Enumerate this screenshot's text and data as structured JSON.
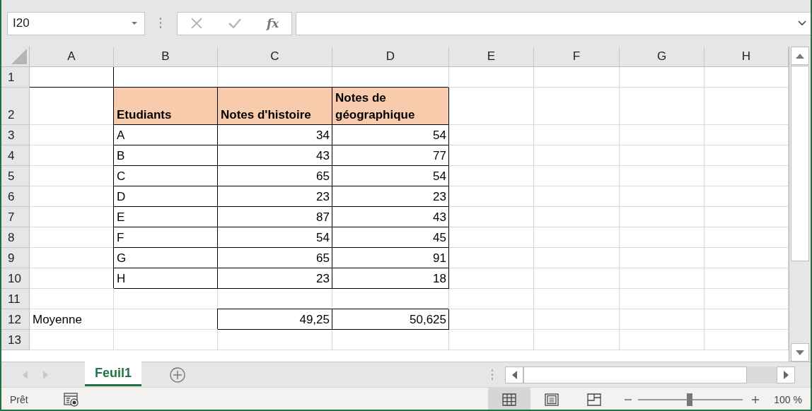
{
  "name_box": {
    "value": "I20"
  },
  "formula_bar": {
    "function_label": "fx"
  },
  "columns": [
    "A",
    "B",
    "C",
    "D",
    "E",
    "F",
    "G",
    "H"
  ],
  "rows": [
    {
      "number": "1",
      "cells": [
        {
          "edge_lines": true
        },
        {},
        {},
        {},
        {},
        {},
        {},
        {}
      ]
    },
    {
      "number": "2",
      "cells": [
        {},
        {
          "text": "Etudiants",
          "bold": true,
          "shaded": true,
          "bordered": true
        },
        {
          "text": "Notes d'histoire",
          "bold": true,
          "shaded": true,
          "bordered": true
        },
        {
          "text": "Notes de géographique",
          "bold": true,
          "shaded": true,
          "bordered": true
        },
        {},
        {},
        {},
        {}
      ]
    },
    {
      "number": "3",
      "cells": [
        {},
        {
          "text": "A",
          "bordered": true
        },
        {
          "text": "34",
          "right_aligned": true,
          "bordered": true
        },
        {
          "text": "54",
          "right_aligned": true,
          "bordered": true
        },
        {},
        {},
        {},
        {}
      ]
    },
    {
      "number": "4",
      "cells": [
        {},
        {
          "text": "B",
          "bordered": true
        },
        {
          "text": "43",
          "right_aligned": true,
          "bordered": true
        },
        {
          "text": "77",
          "right_aligned": true,
          "bordered": true
        },
        {},
        {},
        {},
        {}
      ]
    },
    {
      "number": "5",
      "cells": [
        {},
        {
          "text": "C",
          "bordered": true
        },
        {
          "text": "65",
          "right_aligned": true,
          "bordered": true
        },
        {
          "text": "54",
          "right_aligned": true,
          "bordered": true
        },
        {},
        {},
        {},
        {}
      ]
    },
    {
      "number": "6",
      "cells": [
        {},
        {
          "text": "D",
          "bordered": true
        },
        {
          "text": "23",
          "right_aligned": true,
          "bordered": true
        },
        {
          "text": "23",
          "right_aligned": true,
          "bordered": true
        },
        {},
        {},
        {},
        {}
      ]
    },
    {
      "number": "7",
      "cells": [
        {},
        {
          "text": "E",
          "bordered": true
        },
        {
          "text": "87",
          "right_aligned": true,
          "bordered": true
        },
        {
          "text": "43",
          "right_aligned": true,
          "bordered": true
        },
        {},
        {},
        {},
        {}
      ]
    },
    {
      "number": "8",
      "cells": [
        {},
        {
          "text": "F",
          "bordered": true
        },
        {
          "text": "54",
          "right_aligned": true,
          "bordered": true
        },
        {
          "text": "45",
          "right_aligned": true,
          "bordered": true
        },
        {},
        {},
        {},
        {}
      ]
    },
    {
      "number": "9",
      "cells": [
        {},
        {
          "text": "G",
          "bordered": true
        },
        {
          "text": "65",
          "right_aligned": true,
          "bordered": true
        },
        {
          "text": "91",
          "right_aligned": true,
          "bordered": true
        },
        {},
        {},
        {},
        {}
      ]
    },
    {
      "number": "10",
      "cells": [
        {},
        {
          "text": "H",
          "bordered": true
        },
        {
          "text": "23",
          "right_aligned": true,
          "bordered": true
        },
        {
          "text": "18",
          "right_aligned": true,
          "bordered": true
        },
        {},
        {},
        {},
        {}
      ]
    },
    {
      "number": "11",
      "cells": [
        {},
        {},
        {},
        {},
        {},
        {},
        {},
        {}
      ]
    },
    {
      "number": "12",
      "cells": [
        {
          "text": "Moyenne"
        },
        {},
        {
          "text": "49,25",
          "right_aligned": true,
          "bordered": true
        },
        {
          "text": "50,625",
          "right_aligned": true,
          "bordered": true
        },
        {},
        {},
        {},
        {}
      ]
    },
    {
      "number": "13",
      "cells": [
        {},
        {},
        {},
        {},
        {},
        {},
        {},
        {}
      ]
    }
  ],
  "sheet_tabs": [
    {
      "label": "Feuil1",
      "selected": true
    }
  ],
  "status_bar": {
    "status": "Prêt",
    "views": [
      {
        "kind": "normal",
        "selected": true
      },
      {
        "kind": "page-layout",
        "selected": false
      },
      {
        "kind": "page-break",
        "selected": false
      }
    ],
    "zoom": {
      "level": 0.49,
      "reading": "100 %"
    }
  }
}
